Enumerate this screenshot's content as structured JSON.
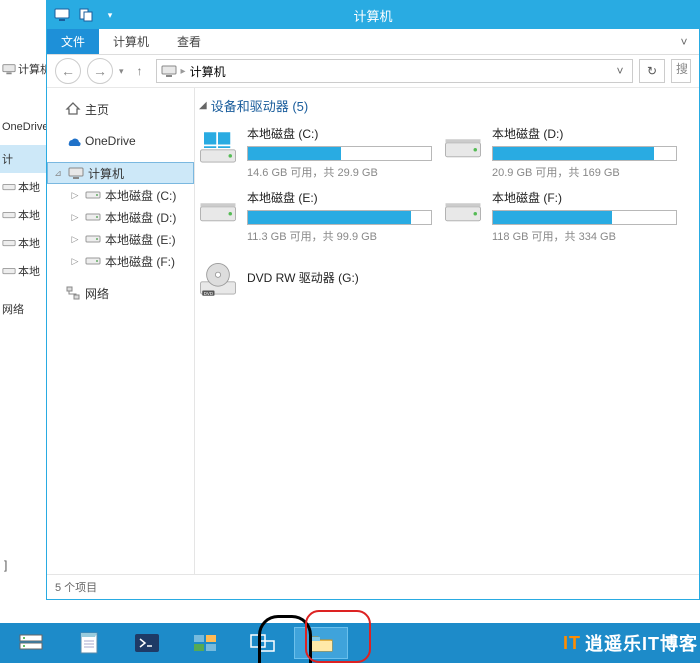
{
  "window_title": "计算机",
  "ribbon": {
    "file_tab": "文件",
    "tabs": [
      "计算机",
      "查看"
    ]
  },
  "breadcrumb": {
    "root": "计算机"
  },
  "search_placeholder": "搜",
  "bg_nav": {
    "computer": "计算机",
    "tree": [
      "计算机",
      "本地",
      "本地",
      "本地",
      "本地"
    ],
    "network": "网络",
    "onedrive": "OneDrive"
  },
  "tree": {
    "home": "主页",
    "onedrive": "OneDrive",
    "computer": "计算机",
    "drives": [
      "本地磁盘 (C:)",
      "本地磁盘 (D:)",
      "本地磁盘 (E:)",
      "本地磁盘 (F:)"
    ],
    "network": "网络"
  },
  "group_header": "设备和驱动器 (5)",
  "drives": [
    {
      "name": "本地磁盘 (C:)",
      "free": "14.6 GB 可用，共 29.9 GB",
      "pct": 51
    },
    {
      "name": "本地磁盘 (D:)",
      "free": "20.9 GB 可用，共 169 GB",
      "pct": 88
    },
    {
      "name": "本地磁盘 (E:)",
      "free": "11.3 GB 可用，共 99.9 GB",
      "pct": 89
    },
    {
      "name": "本地磁盘 (F:)",
      "free": "118 GB 可用，共 334 GB",
      "pct": 65
    }
  ],
  "dvd": "DVD RW 驱动器 (G:)",
  "status": "5 个项目",
  "watermark": "逍遥乐IT博客",
  "left_item": "计"
}
